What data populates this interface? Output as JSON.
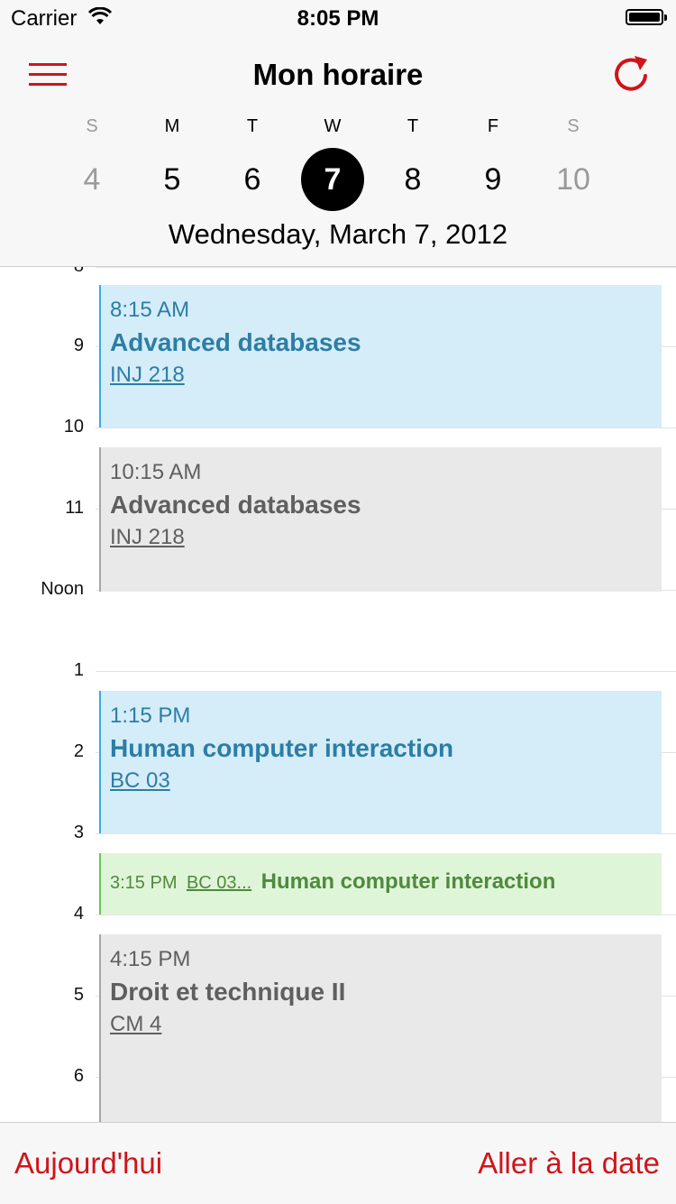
{
  "status_bar": {
    "carrier": "Carrier",
    "time": "8:05 PM"
  },
  "header": {
    "title": "Mon horaire",
    "date_label": "Wednesday, March 7, 2012"
  },
  "week": [
    {
      "letter": "S",
      "number": "4",
      "weekend": true,
      "selected": false
    },
    {
      "letter": "M",
      "number": "5",
      "weekend": false,
      "selected": false
    },
    {
      "letter": "T",
      "number": "6",
      "weekend": false,
      "selected": false
    },
    {
      "letter": "W",
      "number": "7",
      "weekend": false,
      "selected": true
    },
    {
      "letter": "T",
      "number": "8",
      "weekend": false,
      "selected": false
    },
    {
      "letter": "F",
      "number": "9",
      "weekend": false,
      "selected": false
    },
    {
      "letter": "S",
      "number": "10",
      "weekend": true,
      "selected": false
    }
  ],
  "hours": [
    "8",
    "9",
    "10",
    "11",
    "Noon",
    "1",
    "2",
    "3",
    "4",
    "5",
    "6"
  ],
  "events": [
    {
      "time": "8:15 AM",
      "name": "Advanced databases",
      "room": "INJ 218",
      "color": "#d5ecf9"
    },
    {
      "time": "10:15 AM",
      "name": "Advanced databases",
      "room": "INJ 218",
      "color": "#e9e9e9"
    },
    {
      "time": "1:15 PM",
      "name": "Human computer interaction",
      "room": "BC 03",
      "color": "#d5ecf9"
    },
    {
      "time": "3:15 PM",
      "name": "Human computer interaction",
      "room": "BC 03...",
      "color": "#dff5d8"
    },
    {
      "time": "4:15 PM",
      "name": "Droit et technique II",
      "room": "CM 4",
      "color": "#e9e9e9"
    }
  ],
  "toolbar": {
    "today_label": "Aujourd'hui",
    "goto_label": "Aller à la date"
  },
  "colors": {
    "accent": "#d0141b",
    "selected_day": "#000000"
  }
}
